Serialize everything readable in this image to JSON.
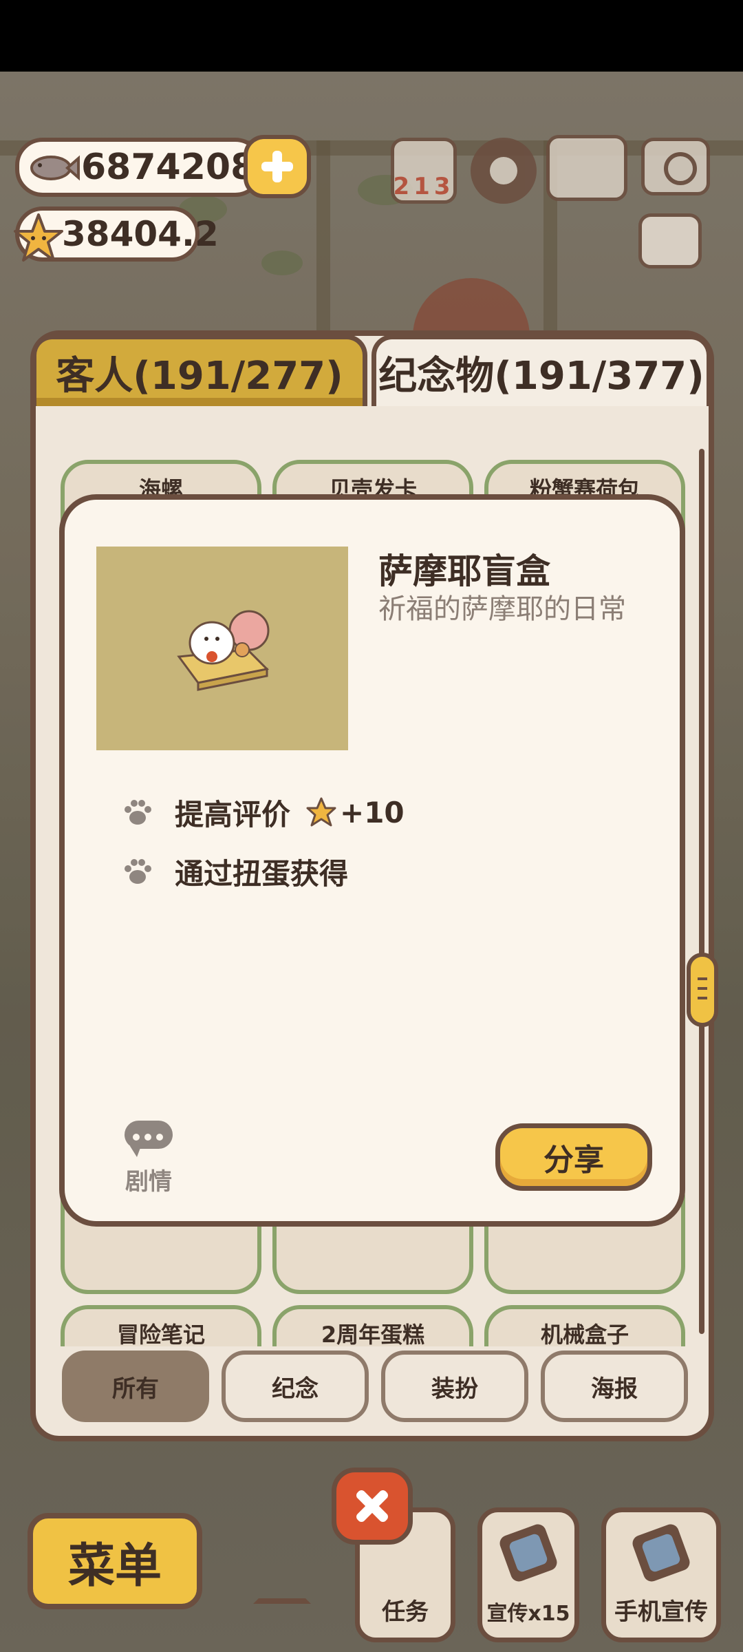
{
  "hud": {
    "fish_currency": "6874208",
    "star_rating": "38404.2",
    "icons": [
      "fish-icon",
      "star-icon",
      "plus-icon",
      "ranking-icon",
      "settings-gear-icon",
      "album-book-icon",
      "camera-icon",
      "news-card-icon"
    ]
  },
  "tabs": [
    {
      "label": "客人(191/277)",
      "active": false
    },
    {
      "label": "纪念物(191/377)",
      "active": true
    }
  ],
  "grid": {
    "row_top": [
      "海螺",
      "贝壳发卡",
      "粉蟹赛荷包"
    ],
    "row_bottom": [
      "冒险笔记",
      "2周年蛋糕",
      "机械盒子"
    ]
  },
  "filters": [
    {
      "label": "所有",
      "active": true
    },
    {
      "label": "纪念",
      "active": false
    },
    {
      "label": "装扮",
      "active": false
    },
    {
      "label": "海报",
      "active": false
    }
  ],
  "modal": {
    "title": "萨摩耶盲盒",
    "subtitle": "祈福的萨摩耶的日常",
    "details": [
      {
        "text": "提高评价",
        "bonus": "+10",
        "icon": "paw-icon"
      },
      {
        "text": "通过扭蛋获得",
        "icon": "paw-icon"
      }
    ],
    "story_label": "剧情",
    "share_label": "分享"
  },
  "bottom_bar": {
    "menu_label": "菜单",
    "task_label": "任务",
    "promo_label": "宣传x15",
    "phone_promo_label": "手机宣传"
  },
  "colors": {
    "accent_yellow": "#f6c64a",
    "outline_brown": "#6b4e3f",
    "panel_cream": "#fbf5ec",
    "card_green_border": "#8aa36a",
    "close_red": "#d9532f"
  }
}
